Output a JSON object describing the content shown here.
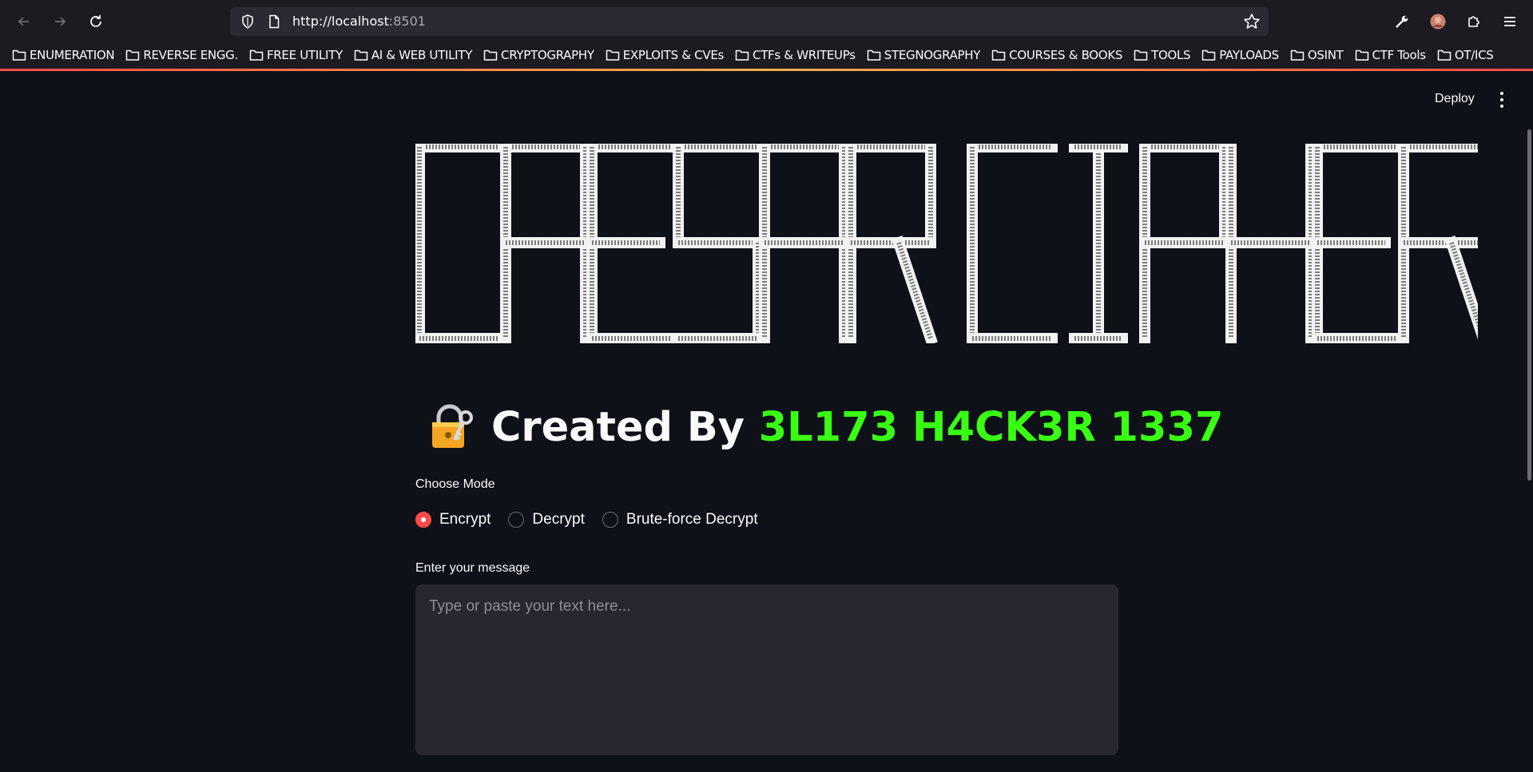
{
  "browser": {
    "url_host": "http://localhost",
    "url_port": ":8501",
    "bookmarks": [
      "ENUMERATION",
      "REVERSE ENGG.",
      "FREE UTILITY",
      "AI & WEB UTILITY",
      "CRYPTOGRAPHY",
      "EXPLOITS & CVEs",
      "CTFs & WRITEUPs",
      "STEGNOGRAPHY",
      "COURSES & BOOKS",
      "TOOLS",
      "PAYLOADS",
      "OSINT",
      "CTF Tools",
      "OT/ICS"
    ]
  },
  "app": {
    "deploy_label": "Deploy",
    "banner_text": "CAESAR CIPHER",
    "title_prefix": "Created By ",
    "title_author": "3L173 H4CK3R 1337",
    "mode_label": "Choose Mode",
    "modes": [
      "Encrypt",
      "Decrypt",
      "Brute-force Decrypt"
    ],
    "selected_mode": "Encrypt",
    "message_label": "Enter your message",
    "message_placeholder": "Type or paste your text here..."
  },
  "colors": {
    "background": "#0e1117",
    "accent": "#ff4b4b",
    "author_green": "#39ff14",
    "input_bg": "#262730"
  },
  "icons": [
    "back-icon",
    "forward-icon",
    "reload-icon",
    "shield-icon",
    "page-icon",
    "star-icon",
    "wrench-icon",
    "profile-avatar",
    "extensions-icon",
    "menu-icon",
    "folder-icon",
    "lock-key-icon",
    "kebab-menu-icon"
  ]
}
